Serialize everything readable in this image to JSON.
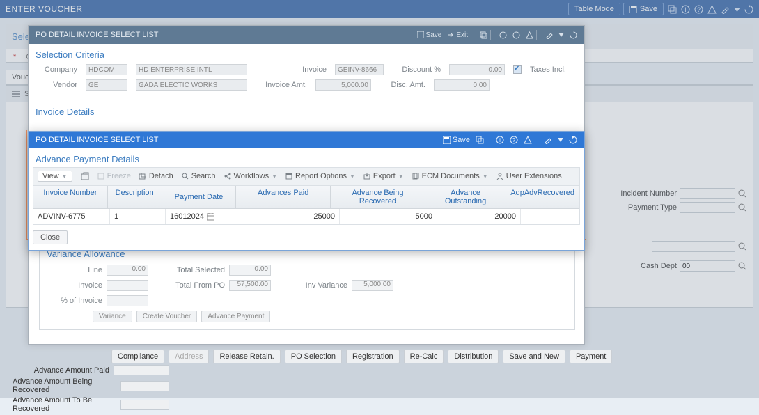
{
  "app": {
    "title": "ENTER VOUCHER",
    "table_mode": "Table Mode",
    "save": "Save"
  },
  "page": {
    "select_header": "Select",
    "company_label": "* Co",
    "vouc_tab": "Vouc",
    "info_strip_icon": "S"
  },
  "right": {
    "incident_number": "Incident Number",
    "payment_type": "Payment Type"
  },
  "cash_dept": {
    "label": "Cash Dept",
    "value": "00"
  },
  "bottom": {
    "compliance": "Compliance",
    "address": "Address",
    "release_retain": "Release Retain.",
    "po_selection": "PO Selection",
    "registration": "Registration",
    "recalc": "Re-Calc",
    "distribution": "Distribution",
    "save_and_new": "Save and New",
    "payment": "Payment"
  },
  "adv_labels": {
    "paid": "Advance Amount Paid",
    "being": "Advance Amount Being Recovered",
    "tobe": "Advance Amount To Be Recovered"
  },
  "dlg1": {
    "title": "PO DETAIL INVOICE SELECT LIST",
    "save": "Save",
    "exit": "Exit",
    "sc_title": "Selection Criteria",
    "company_l": "Company",
    "company_v": "HDCOM",
    "company_name": "HD ENTERPRISE INTL",
    "vendor_l": "Vendor",
    "vendor_v": "GE",
    "vendor_name": "GADA ELECTIC WORKS",
    "invoice_l": "Invoice",
    "invoice_v": "GEINV-8666",
    "invamt_l": "Invoice Amt.",
    "invamt_v": "5,000.00",
    "discpct_l": "Discount %",
    "discpct_v": "0.00",
    "discamt_l": "Disc. Amt.",
    "discamt_v": "0.00",
    "taxes_l": "Taxes Incl.",
    "inv_details": "Invoice Details"
  },
  "variance": {
    "title": "Variance Allowance",
    "line_l": "Line",
    "line_v": "0.00",
    "invoice_l": "Invoice",
    "pctinv_l": "% of Invoice",
    "totsel_l": "Total Selected",
    "totsel_v": "0.00",
    "totpo_l": "Total From PO",
    "totpo_v": "57,500.00",
    "invvar_l": "Inv Variance",
    "invvar_v": "5,000.00",
    "btn_variance": "Variance",
    "btn_create": "Create Voucher",
    "btn_advance": "Advance Payment"
  },
  "modal": {
    "title": "PO DETAIL INVOICE SELECT LIST",
    "save": "Save",
    "apd_title": "Advance Payment Details",
    "close": "Close",
    "toolbar": {
      "view": "View",
      "freeze": "Freeze",
      "detach": "Detach",
      "search": "Search",
      "workflows": "Workflows",
      "report": "Report Options",
      "export": "Export",
      "ecm": "ECM Documents",
      "user_ext": "User Extensions"
    },
    "chart_data": {
      "type": "table",
      "columns": [
        "Invoice Number",
        "Description",
        "Payment Date",
        "Advances Paid",
        "Advance Being Recovered",
        "Advance Outstanding",
        "AdpAdvRecovered"
      ],
      "rows": [
        {
          "invoice_number": "ADVINV-6775",
          "description": "1",
          "payment_date": "16012024",
          "advances_paid": "25000",
          "advance_being_recovered": "5000",
          "advance_outstanding": "20000",
          "adp_adv_recovered": ""
        }
      ]
    }
  }
}
